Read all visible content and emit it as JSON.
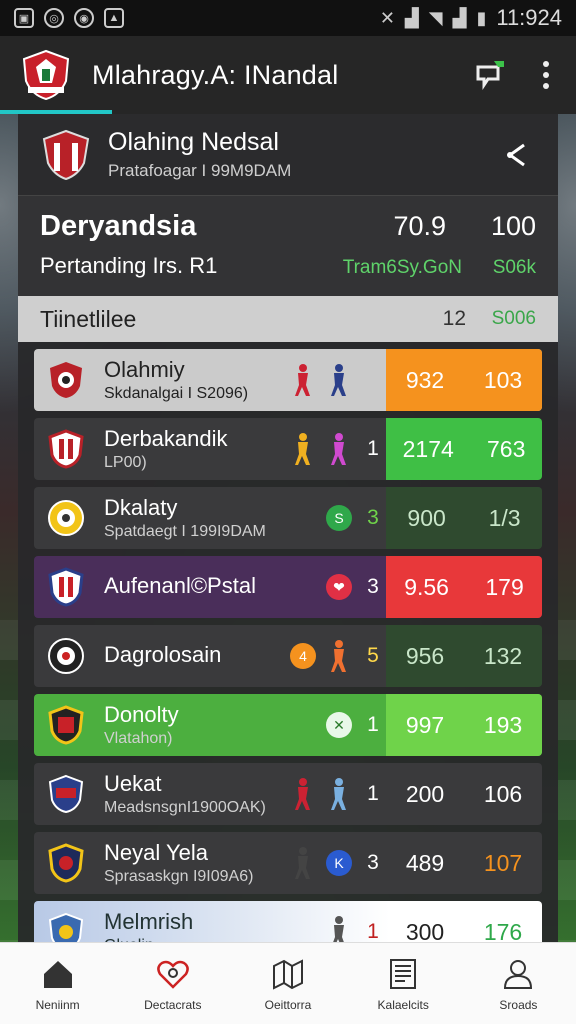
{
  "status_bar": {
    "time": "11:924"
  },
  "app_bar": {
    "title": "Mlahragy.A: INandal"
  },
  "team_header": {
    "name": "Olahing Nedsal",
    "subtitle": "Pratafoagar I 99M9DAM"
  },
  "summary": {
    "title": "Deryandsia",
    "value_1": "70.9",
    "value_2": "100",
    "subtitle": "Pertanding Irs. R1",
    "green_1": "Tram6Sy.GoN",
    "green_2": "S06k"
  },
  "table_header": {
    "label": "Tiinetlilee",
    "value": "12",
    "value_2": "S006"
  },
  "rows": [
    {
      "name": "Olahmiy",
      "sub": "Skdanalgai I S2096)",
      "rank": "",
      "score_1": "932",
      "score_2": "103",
      "style": "light",
      "score_style": "sc-orange"
    },
    {
      "name": "Derbakandik",
      "sub": "LP00)",
      "rank": "1",
      "score_1": "2174",
      "score_2": "763",
      "style": "",
      "score_style": "sc-green"
    },
    {
      "name": "Dkalaty",
      "sub": "Spatdaegt I 199I9DAM",
      "rank": "3",
      "score_1": "900",
      "score_2": "1/3",
      "style": "",
      "score_style": "sc-dark",
      "badge": "S"
    },
    {
      "name": "Aufenanl©Pstal",
      "sub": "",
      "rank": "3",
      "score_1": "9.56",
      "score_2": "179",
      "style": "purple",
      "score_style": "sc-red",
      "badge": "❤"
    },
    {
      "name": "Dagrolosain",
      "sub": "",
      "rank": "5",
      "score_1": "956",
      "score_2": "132",
      "style": "",
      "score_style": "sc-dark",
      "badge": "4"
    },
    {
      "name": "Donolty",
      "sub": "Vlatahon)",
      "rank": "1",
      "score_1": "997",
      "score_2": "193",
      "style": "green",
      "score_style": "sc-lime",
      "badge": "✕"
    },
    {
      "name": "Uekat",
      "sub": "MeadsnsgnI1900OAK)",
      "rank": "1",
      "score_1": "200",
      "score_2": "106",
      "style": "",
      "score_style": "sc-plain"
    },
    {
      "name": "Neyal Yela",
      "sub": "Sprasaskgn I9I09A6)",
      "rank": "3",
      "score_1": "489",
      "score_2": "107",
      "style": "",
      "score_style": "sc-plain",
      "badge": "K"
    },
    {
      "name": "Melmrish",
      "sub": "Gluelin",
      "rank": "1",
      "score_1": "300",
      "score_2": "176",
      "style": "pale",
      "score_style": "sc-plain"
    }
  ],
  "bottom_nav": [
    {
      "label": "Neniinm",
      "icon": "home-icon"
    },
    {
      "label": "Dectacrats",
      "icon": "heart-icon"
    },
    {
      "label": "Oeittorra",
      "icon": "map-icon"
    },
    {
      "label": "Kalaelcits",
      "icon": "news-icon"
    },
    {
      "label": "Sroads",
      "icon": "profile-icon"
    }
  ],
  "colors": {
    "accent": "#22c7c7",
    "orange": "#f5921e",
    "green": "#3fbf45",
    "red": "#e8383a",
    "lime": "#6fd34a"
  }
}
